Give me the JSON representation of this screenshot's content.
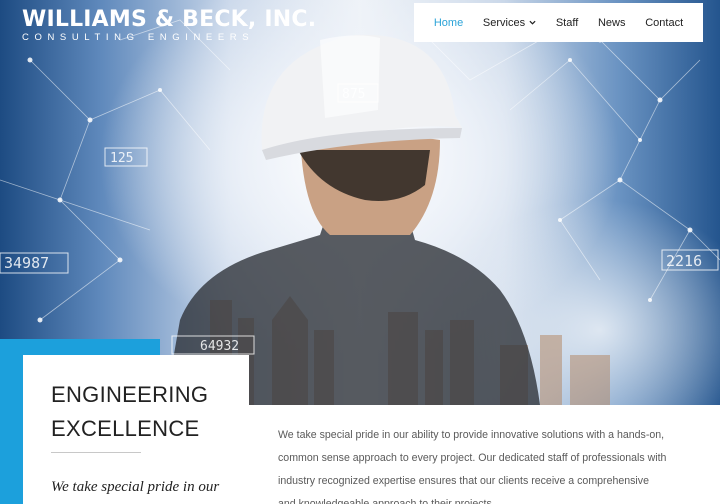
{
  "brand": {
    "name": "WILLIAMS & BECK, INC.",
    "tagline": "CONSULTING ENGINEERS"
  },
  "nav": {
    "items": [
      {
        "label": "Home",
        "active": true
      },
      {
        "label": "Services",
        "has_dropdown": true
      },
      {
        "label": "Staff"
      },
      {
        "label": "News"
      },
      {
        "label": "Contact"
      }
    ]
  },
  "hero": {
    "overlay_numbers": [
      "875",
      "125",
      "34987",
      "2216",
      "64932"
    ]
  },
  "card": {
    "title_line1": "ENGINEERING",
    "title_line2": "EXCELLENCE",
    "quote": "We take special pride in our"
  },
  "intro": {
    "text": "We take special pride in our ability to provide innovative solutions with a hands-on, common sense approach to every project. Our dedicated staff of professionals with industry recognized expertise ensures that our clients receive a comprehensive and knowledgeable approach to their projects."
  },
  "colors": {
    "accent": "#1ca0dc",
    "nav_active": "#2ba3d8",
    "text_dark": "#222222",
    "text_body": "#5a5a5a"
  },
  "icons": {
    "services_dropdown": "chevron-down-icon"
  }
}
